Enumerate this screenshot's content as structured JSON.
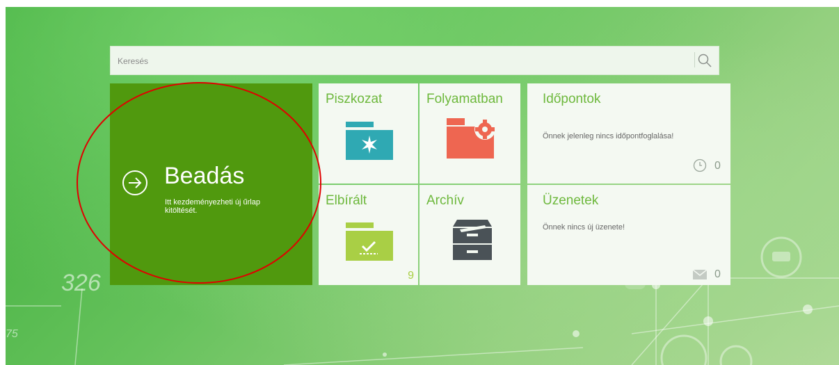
{
  "search": {
    "placeholder": "Keresés",
    "icon": "search-icon"
  },
  "beadas": {
    "title": "Beadás",
    "subtitle": "Itt kezdeményezheti új űrlap kitöltését.",
    "color": "#50990e",
    "icon": "arrow-right-circle-icon"
  },
  "tiles": {
    "piszkozat": {
      "title": "Piszkozat",
      "icon": "draft-folder-icon",
      "color": "#2fa9b3"
    },
    "folyamatban": {
      "title": "Folyamatban",
      "icon": "in-progress-folder-icon",
      "color": "#ee6651"
    },
    "elbiralt": {
      "title": "Elbírált",
      "count": "9",
      "icon": "checked-folder-icon",
      "color": "#a9cf45"
    },
    "archiv": {
      "title": "Archív",
      "icon": "archive-cabinet-icon",
      "color": "#4a5257"
    }
  },
  "idopontok": {
    "title": "Időpontok",
    "message": "Önnek jelenleg nincs időpontfoglalása!",
    "count": "0",
    "icon": "clock-icon"
  },
  "uzenetek": {
    "title": "Üzenetek",
    "message": "Önnek nincs új üzenete!",
    "count": "0",
    "icon": "envelope-icon"
  },
  "background": {
    "numbers": [
      "326",
      "75"
    ]
  },
  "accent": "#6db83c",
  "highlight_color": "#e00000"
}
